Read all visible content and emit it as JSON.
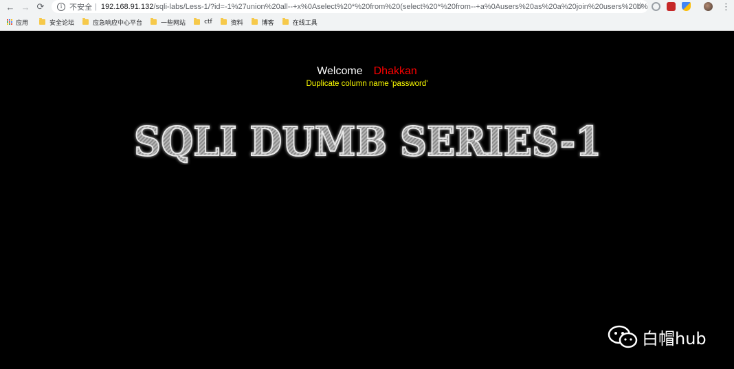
{
  "browser": {
    "security_label": "不安全",
    "separator": "|",
    "url_host": "192.168.91.132",
    "url_path": "/sqli-labs/Less-1/?id=-1%27union%20all--+x%0Aselect%20*%20from%20(select%20*%20from--+a%0Ausers%20as%20a%20join%20users%20b%20...",
    "bookmarks": [
      {
        "label": "应用",
        "icon": "apps-icon"
      },
      {
        "label": "安全论坛",
        "icon": "folder-icon"
      },
      {
        "label": "应急响应中心平台",
        "icon": "folder-icon"
      },
      {
        "label": "一些网站",
        "icon": "folder-icon"
      },
      {
        "label": "ctf",
        "icon": "folder-icon"
      },
      {
        "label": "资料",
        "icon": "folder-icon"
      },
      {
        "label": "博客",
        "icon": "folder-icon"
      },
      {
        "label": "在线工具",
        "icon": "folder-icon"
      }
    ]
  },
  "page": {
    "welcome": "Welcome",
    "username": "Dhakkan",
    "error_message": "Duplicate column name 'password'",
    "title_image_text": "SQLI DUMB SERIES-1"
  },
  "watermark": {
    "text": "白帽hub",
    "icon": "wechat-icon"
  },
  "colors": {
    "background": "#000000",
    "welcome": "#ffffff",
    "username": "#ff0000",
    "error": "#ffff00"
  }
}
